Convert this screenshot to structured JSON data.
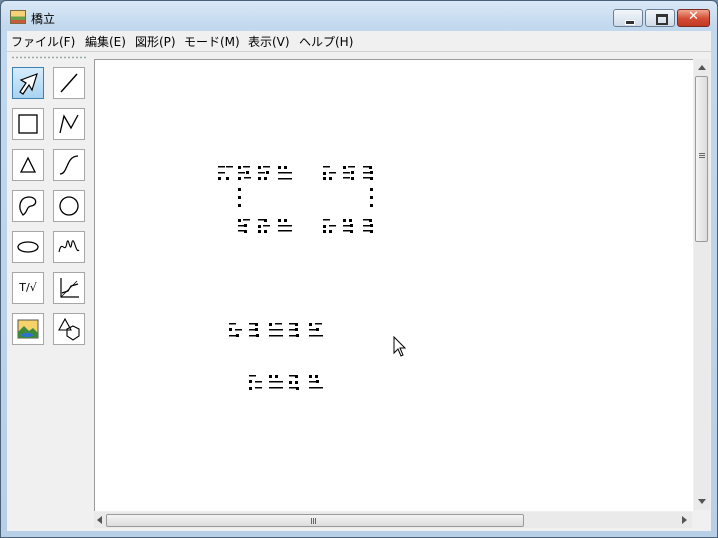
{
  "window": {
    "title": "橋立",
    "app_icon": "hashidate-app-icon",
    "controls": [
      "minimize-icon",
      "maximize-icon",
      "close-icon"
    ],
    "close_glyph": "✕"
  },
  "menu": [
    {
      "label": "ファイル(F)"
    },
    {
      "label": "編集(E)"
    },
    {
      "label": "図形(P)"
    },
    {
      "label": "モード(M)"
    },
    {
      "label": "表示(V)"
    },
    {
      "label": "ヘルプ(H)"
    }
  ],
  "tools": [
    {
      "icon": "select-arrow-icon",
      "active": true
    },
    {
      "icon": "line-icon"
    },
    {
      "icon": "rectangle-icon"
    },
    {
      "icon": "polyline-icon"
    },
    {
      "icon": "triangle-icon"
    },
    {
      "icon": "curve-icon"
    },
    {
      "icon": "freeform-closed-icon"
    },
    {
      "icon": "circle-icon"
    },
    {
      "icon": "ellipse-icon"
    },
    {
      "icon": "scribble-icon"
    },
    {
      "icon": "text-math-icon",
      "label": "T/√"
    },
    {
      "icon": "graph-axes-icon"
    },
    {
      "icon": "picture-icon"
    },
    {
      "icon": "shapes-icon"
    }
  ],
  "canvas": {
    "content": "tactile braille graphics",
    "cursor": "mouse-pointer-icon",
    "ink_color": "#000000"
  },
  "colors": {
    "title_bar": "#c2d8ee",
    "close_button": "#d34b33",
    "active_tool": "#a9d3f1"
  }
}
